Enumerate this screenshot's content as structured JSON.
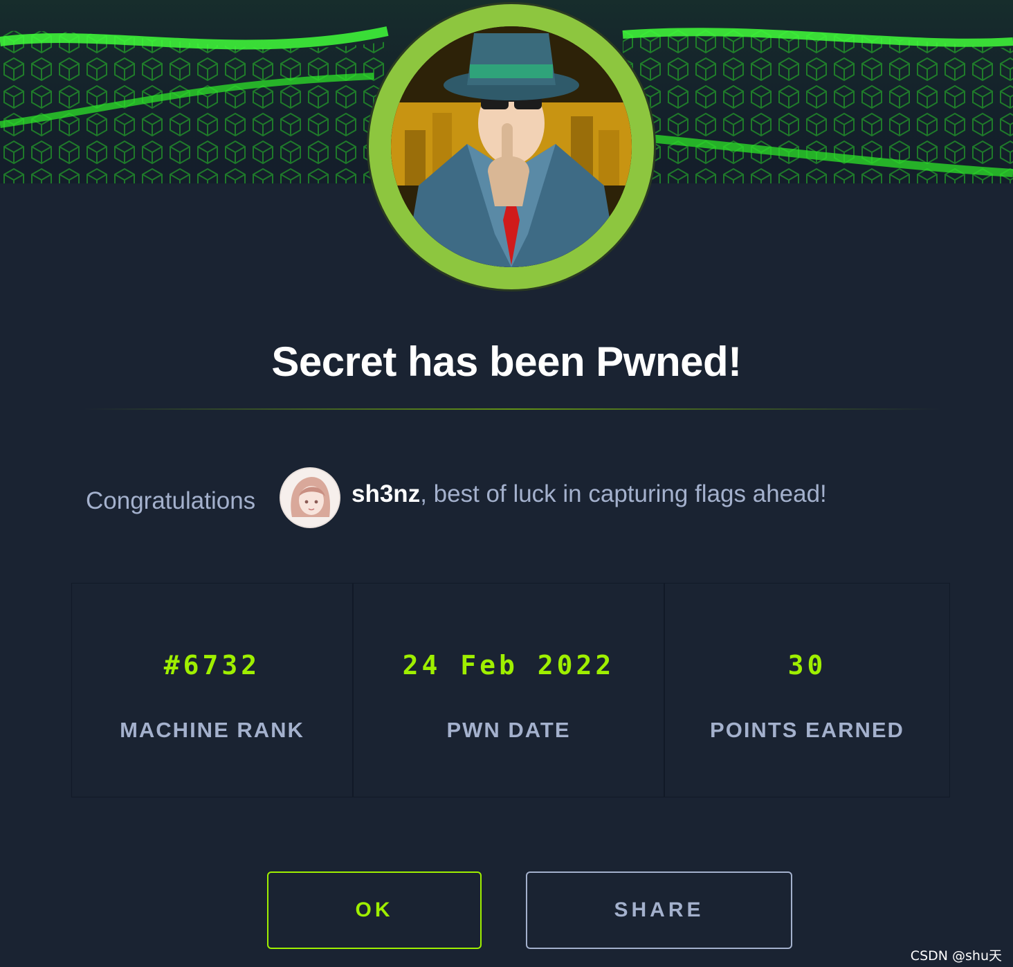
{
  "dialog": {
    "title": "Secret has been Pwned!",
    "congrats_prefix": "Congratulations",
    "username": "sh3nz",
    "message_suffix": ", best of luck in capturing flags ahead!"
  },
  "stats": [
    {
      "value": "#6732",
      "label": "MACHINE RANK"
    },
    {
      "value": "24 Feb 2022",
      "label": "PWN DATE"
    },
    {
      "value": "30",
      "label": "POINTS EARNED"
    }
  ],
  "buttons": {
    "ok_label": "OK",
    "share_label": "SHARE"
  },
  "watermark": "CSDN @shu天",
  "icons": {
    "machine_avatar": "secret-agent-icon",
    "user_avatar": "anime-girl-avatar"
  },
  "colors": {
    "background": "#1a2332",
    "accent": "#9fef00",
    "ring": "#8dc63f",
    "text_muted": "#a4b1cd",
    "title": "#ffffff"
  }
}
